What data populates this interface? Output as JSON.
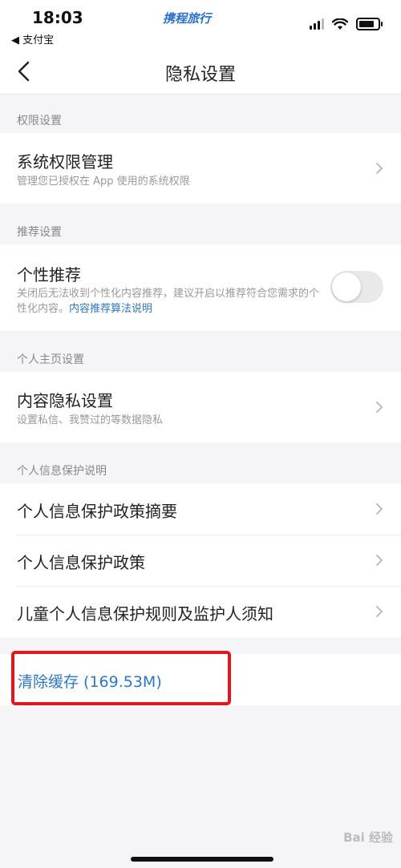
{
  "status_bar": {
    "time": "18:03",
    "back_app": "◀ 支付宝",
    "brand": "携程旅行"
  },
  "nav": {
    "title": "隐私设置"
  },
  "sections": {
    "permissions": {
      "header": "权限设置",
      "item_title": "系统权限管理",
      "item_subtitle": "管理您已授权在 App 使用的系统权限"
    },
    "recommend": {
      "header": "推荐设置",
      "item_title": "个性推荐",
      "item_subtitle": "关闭后无法收到个性化内容推荐，建议开启以推荐符合您需求的个性化内容。",
      "item_link": "内容推荐算法说明",
      "toggle_on": false
    },
    "profile": {
      "header": "个人主页设置",
      "item_title": "内容隐私设置",
      "item_subtitle": "设置私信、我赞过的等数据隐私"
    },
    "protection": {
      "header": "个人信息保护说明",
      "items": [
        "个人信息保护政策摘要",
        "个人信息保护政策",
        "儿童个人信息保护规则及监护人须知"
      ]
    }
  },
  "cache": {
    "label": "清除缓存 (169.53M)"
  },
  "colors": {
    "link": "#2a76d2",
    "highlight_border": "#e3161d",
    "background": "#f5f5f7"
  },
  "watermark": "Bai 经验"
}
